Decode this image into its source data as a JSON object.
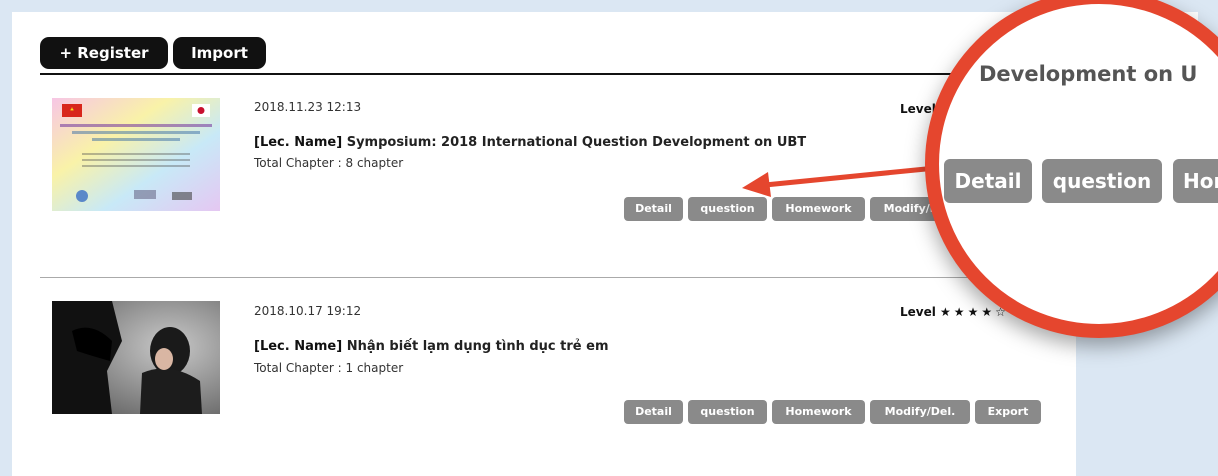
{
  "toolbar": {
    "register_label": "+ Register",
    "import_label": "Import"
  },
  "lectures": [
    {
      "datetime": "2018.11.23 12:13",
      "lec_prefix": "[Lec. Name]",
      "name": "Symposium: 2018 International Question Development on UBT",
      "chapters": "Total Chapter : 8 chapter",
      "level_label": "Level",
      "actions": [
        "Detail",
        "question",
        "Homework",
        "Modify/Del."
      ]
    },
    {
      "datetime": "2018.10.17 19:12",
      "lec_prefix": "[Lec. Name]",
      "name": "Nhận biết lạm dụng tình dục trẻ em",
      "chapters": "Total Chapter : 1 chapter",
      "level_label": "Level",
      "level_stars": "★★★★☆",
      "actions": [
        "Detail",
        "question",
        "Homework",
        "Modify/Del.",
        "Export"
      ]
    }
  ],
  "zoom": {
    "title_fragment": "Development on U",
    "buttons": [
      "Detail",
      "question",
      "Hom"
    ]
  },
  "colors": {
    "accent_ring": "#e5462e",
    "button_gray": "#8a8a8a"
  }
}
